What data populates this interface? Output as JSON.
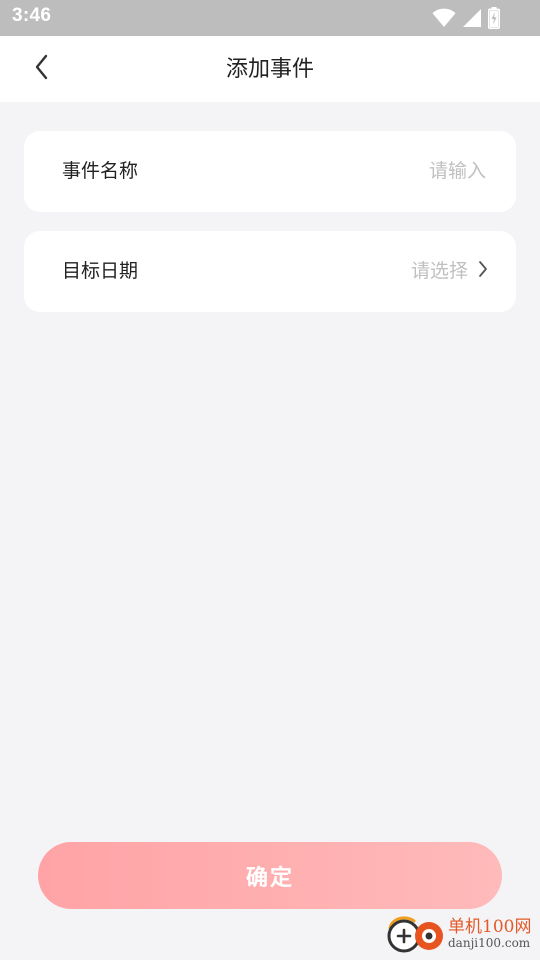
{
  "status_bar": {
    "time": "3:46",
    "icons": [
      "wifi-icon",
      "signal-icon",
      "battery-charging-icon"
    ]
  },
  "nav": {
    "back_icon": "chevron-left-icon",
    "title": "添加事件"
  },
  "form": {
    "event_name": {
      "label": "事件名称",
      "value": "",
      "placeholder": "请输入"
    },
    "target_date": {
      "label": "目标日期",
      "placeholder": "请选择",
      "icon": "chevron-right-icon"
    }
  },
  "confirm_label": "确定",
  "watermark": {
    "site_name": "单机100网",
    "url": "danji100.com"
  },
  "colors": {
    "background": "#f4f4f6",
    "status_bar": "#bdbdbd",
    "button_start": "#ffa3a6",
    "button_end": "#ffbaba",
    "placeholder": "#c0c0c0",
    "watermark_accent": "#e25a2a"
  }
}
